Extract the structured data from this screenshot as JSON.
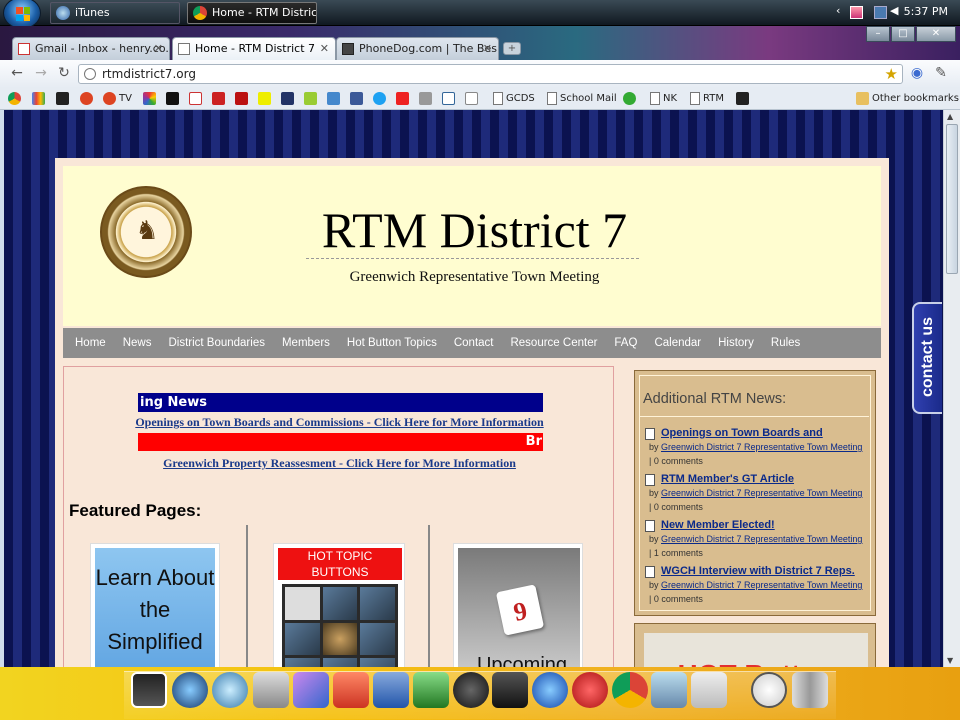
{
  "taskbar": {
    "itunes_label": "iTunes",
    "chrome_label": "Home - RTM Distric...",
    "clock": "5:37 PM"
  },
  "browser": {
    "tabs": [
      {
        "label": "Gmail - Inbox - henry.co...",
        "close": "✕"
      },
      {
        "label": "Home - RTM District 7",
        "close": "✕"
      },
      {
        "label": "PhoneDog.com | The Bes...",
        "close": "✕"
      }
    ],
    "new_tab": "+",
    "url": "rtmdistrict7.org",
    "bookmarks": {
      "tv": "TV",
      "gcds": "GCDS",
      "school_mail": "School Mail",
      "nk": "NK",
      "rtm": "RTM",
      "other": "Other bookmarks"
    },
    "window_controls": {
      "minimize": "–",
      "maximize": "□",
      "close": "✕"
    }
  },
  "site": {
    "title": "RTM District 7",
    "subtitle": "Greenwich Representative Town Meeting",
    "nav": [
      "Home",
      "News",
      "District Boundaries",
      "Members",
      "Hot Button Topics",
      "Contact",
      "Resource Center",
      "FAQ",
      "Calendar",
      "History",
      "Rules"
    ],
    "banner_blue": "ing News",
    "link_openings": "Openings on Town Boards and Commissions - Click Here for More Information",
    "banner_red": "Br",
    "link_reassessment": "Greenwich Property Reassesment - Click Here for More Information",
    "featured_heading": "Featured Pages:",
    "featured": {
      "learn_text": "Learn About the Simplified",
      "hot_topic_text": "HOT TOPIC BUTTONS",
      "calendar_day": "9",
      "upcoming_text": "Upcoming"
    },
    "sidebar": {
      "title": "Additional RTM News:",
      "items": [
        {
          "title": "Openings on Town Boards and",
          "by_prefix": "by ",
          "author": "Greenwich District 7 Representative Town Meeting",
          "comments": "| 0 comments"
        },
        {
          "title": "RTM Member's GT Article",
          "by_prefix": "by ",
          "author": "Greenwich District 7 Representative Town Meeting",
          "comments": "| 0 comments"
        },
        {
          "title": "New Member Elected!",
          "by_prefix": "by ",
          "author": "Greenwich District 7 Representative Town Meeting",
          "comments": "| 1 comments"
        },
        {
          "title": "WGCH Interview with District 7 Reps.",
          "by_prefix": "by ",
          "author": "Greenwich District 7 Representative Town Meeting",
          "comments": "| 0 comments"
        }
      ],
      "hot_button_text": "HOT Button"
    },
    "contact_tab": "contact us"
  },
  "colors": {
    "nav_bg": "#8d8d8d",
    "header_bg": "#fffdd0",
    "banner_blue": "#00008b",
    "banner_red": "#ff0000",
    "link": "#1a3a8a",
    "sidebar_bg": "#d9bd8f",
    "dock_yellow": "#f2d420"
  }
}
